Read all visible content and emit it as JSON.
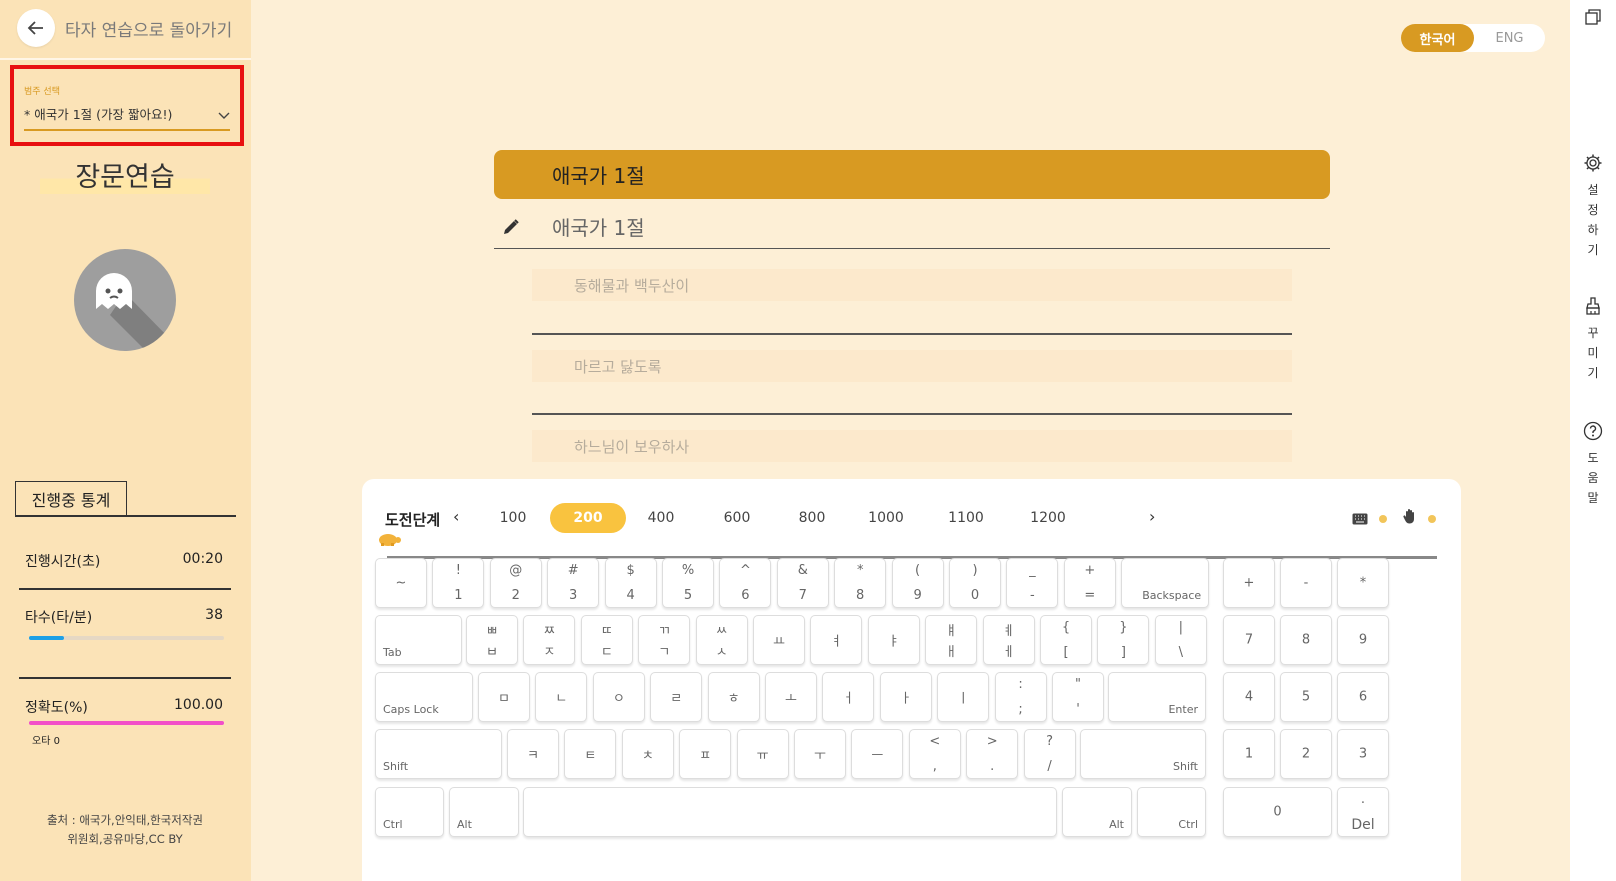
{
  "back": {
    "label": "타자 연습으로 돌아가기"
  },
  "category": {
    "caption": "범주 선택",
    "value": "* 애국가 1절 (가장 짧아요!)"
  },
  "mode_title": "장문연습",
  "stats": {
    "tab": "진행중 통계",
    "time_label": "진행시간(초)",
    "time_value": "00:20",
    "speed_label": "타수(타/분)",
    "speed_value": "38",
    "speed_fraction": 0.18,
    "accuracy_label": "정확도(%)",
    "accuracy_value": "100.00",
    "accuracy_fraction": 1.0,
    "errors": "오타 0"
  },
  "source": {
    "line1": "출처 : 애국가,안익태,한국저작권",
    "line2": "위원회,공유마당,CC BY"
  },
  "lang": {
    "ko": "한국어",
    "en": "ENG"
  },
  "sidebar": {
    "settings": "설정하기",
    "decorate": "꾸미기",
    "help": "도움말"
  },
  "text": {
    "current_title": "애국가 1절",
    "current_input": "애국가 1절",
    "next_lines": [
      "동해물과 백두산이",
      "마르고 닳도록",
      "하느님이 보우하사"
    ]
  },
  "levels": {
    "label": "도전단계",
    "values": [
      "100",
      "200",
      "400",
      "600",
      "800",
      "1000",
      "1100",
      "1200"
    ],
    "selected": "200"
  },
  "colors": {
    "accent": "#D89A22",
    "speed_bar": "#1EA0E6",
    "accuracy_bar": "#F24FC8",
    "highlight": "#E81010"
  },
  "keyboard": {
    "row1": [
      [
        "~",
        ""
      ],
      [
        "!",
        "1"
      ],
      [
        "@",
        "2"
      ],
      [
        "#",
        "3"
      ],
      [
        "$",
        "4"
      ],
      [
        "%",
        "5"
      ],
      [
        "^",
        "6"
      ],
      [
        "&",
        "7"
      ],
      [
        "*",
        "8"
      ],
      [
        "(",
        "9"
      ],
      [
        ")",
        "0"
      ],
      [
        "_",
        "-"
      ],
      [
        "+",
        "="
      ]
    ],
    "backspace": "Backspace",
    "tab": "Tab",
    "row2": [
      [
        "ㅃ",
        "ㅂ"
      ],
      [
        "ㅉ",
        "ㅈ"
      ],
      [
        "ㄸ",
        "ㄷ"
      ],
      [
        "ㄲ",
        "ㄱ"
      ],
      [
        "ㅆ",
        "ㅅ"
      ],
      [
        "",
        "ㅛ"
      ],
      [
        "",
        "ㅕ"
      ],
      [
        "",
        "ㅑ"
      ],
      [
        "ㅒ",
        "ㅐ"
      ],
      [
        "ㅖ",
        "ㅔ"
      ],
      [
        "{",
        "["
      ],
      [
        "}",
        "]"
      ],
      [
        "|",
        "\\"
      ]
    ],
    "caps": "Caps Lock",
    "row3": [
      [
        "",
        "ㅁ"
      ],
      [
        "",
        "ㄴ"
      ],
      [
        "",
        "ㅇ"
      ],
      [
        "",
        "ㄹ"
      ],
      [
        "",
        "ㅎ"
      ],
      [
        "",
        "ㅗ"
      ],
      [
        "",
        "ㅓ"
      ],
      [
        "",
        "ㅏ"
      ],
      [
        "",
        "ㅣ"
      ],
      [
        ":",
        ";"
      ],
      [
        "\"",
        "'"
      ]
    ],
    "enter": "Enter",
    "shift": "Shift",
    "row4": [
      [
        "",
        "ㅋ"
      ],
      [
        "",
        "ㅌ"
      ],
      [
        "",
        "ㅊ"
      ],
      [
        "",
        "ㅍ"
      ],
      [
        "",
        "ㅠ"
      ],
      [
        "",
        "ㅜ"
      ],
      [
        "",
        "ㅡ"
      ],
      [
        "<",
        ","
      ],
      [
        ">",
        "."
      ],
      [
        "?",
        "/"
      ]
    ],
    "ctrl": "Ctrl",
    "alt": "Alt",
    "numpad": {
      "top": [
        "+",
        "-",
        "*"
      ],
      "r1": [
        "7",
        "8",
        "9"
      ],
      "r2": [
        "4",
        "5",
        "6"
      ],
      "r3": [
        "1",
        "2",
        "3"
      ],
      "zero": "0",
      "dot": ".",
      "del": "Del"
    }
  }
}
